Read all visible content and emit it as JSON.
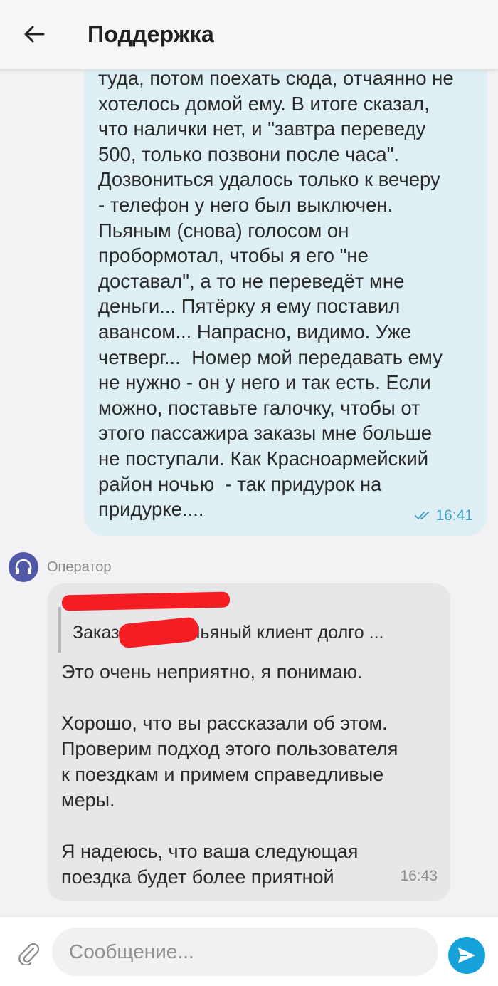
{
  "header": {
    "title": "Поддержка",
    "back_icon": "arrow-left-icon"
  },
  "messages": {
    "outgoing": {
      "text": "туда, потом поехать сюда, отчаянно не\nхотелось домой ему. В итоге сказал,\nчто налички нет, и \"завтра переведу\n500, только позвони после часа\".\nДозвониться удалось только к вечеру\n- телефон у него был выключен.\nПьяным (снова) голосом он\nпробормотал, чтобы я его \"не\nдоставал\", а то не переведёт мне\nденьги... Пятёрку я ему поставил\nавансом... Напрасно, видимо. Уже\nчетверг...  Номер мой передавать ему\nне нужно - он у него и так есть. Если\nможно, поставьте галочку, чтобы от\nэтого пассажира заказы мне больше\nне поступали. Как Красноармейский\nрайон ночью  - так придурок на\nпридурке....",
      "time": "16:41",
      "status_icon": "double-check-icon"
    },
    "operator": {
      "name": "Оператор",
      "avatar_icon": "headphones-icon",
      "quote_prefix": "Заказ",
      "quote_suffix": "Пьяный клиент долго ...",
      "text": "Это очень неприятно, я понимаю.\n\nХорошо, что вы рассказали об этом.\nПроверим подход этого пользователя\nк поездкам и примем справедливые\nмеры.\n\nЯ надеюсь, что ваша следующая\nпоездка будет более приятной",
      "time": "16:43"
    }
  },
  "input": {
    "placeholder": "Сообщение...",
    "attach_icon": "paperclip-icon",
    "send_icon": "send-icon"
  },
  "colors": {
    "outgoing_bubble": "#dff0f5",
    "incoming_bubble": "#e7e7ea",
    "accent": "#16a2d9",
    "avatar": "#5058a7",
    "redaction": "#f51d24"
  }
}
